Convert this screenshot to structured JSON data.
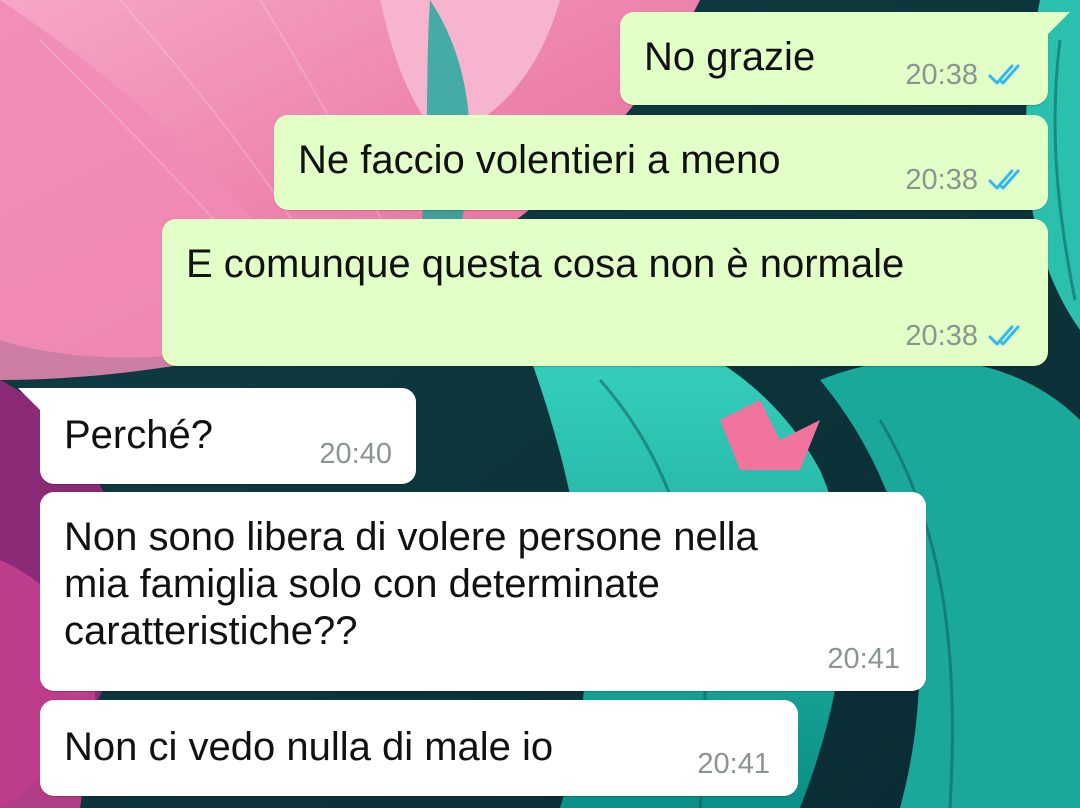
{
  "colors": {
    "outgoing_bubble": "#e2ffc8",
    "incoming_bubble": "#ffffff",
    "timestamp": "#8b9590",
    "read_ticks": "#34b7f1"
  },
  "messages": [
    {
      "direction": "outgoing",
      "lines": [
        "No grazie"
      ],
      "time": "20:38",
      "status": "read"
    },
    {
      "direction": "outgoing",
      "lines": [
        "Ne faccio volentieri a meno"
      ],
      "time": "20:38",
      "status": "read"
    },
    {
      "direction": "outgoing",
      "lines": [
        "E comunque questa cosa non è normale"
      ],
      "time": "20:38",
      "status": "read"
    },
    {
      "direction": "incoming",
      "lines": [
        "Perché?"
      ],
      "time": "20:40"
    },
    {
      "direction": "incoming",
      "lines": [
        "Non sono libera di volere persone nella",
        "mia famiglia solo con determinate",
        "caratteristiche??"
      ],
      "time": "20:41"
    },
    {
      "direction": "incoming",
      "lines": [
        "Non ci vedo nulla di male io"
      ],
      "time": "20:41"
    }
  ]
}
